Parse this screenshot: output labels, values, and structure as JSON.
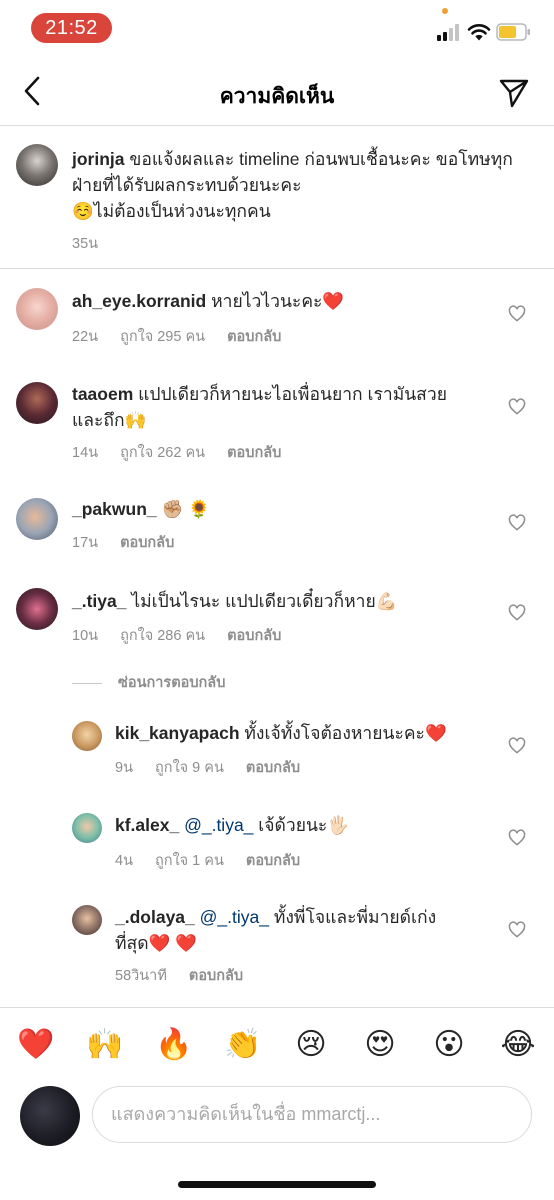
{
  "status_bar": {
    "time": "21:52"
  },
  "header": {
    "title": "ความคิดเห็น"
  },
  "caption": {
    "username": "jorinja",
    "text_line1": " ขอแจ้งผลและ timeline ก่อนพบเชื้อนะคะ ขอโทษทุก",
    "text_line2": "ฝ่ายที่ได้รับผลกระทบด้วยนะคะ",
    "text_line3": "☺️ไม่ต้องเป็นห่วงนะทุกคน",
    "time": "35น"
  },
  "comments": [
    {
      "username": "ah_eye.korranid",
      "text": " หายไวไวนะคะ❤️",
      "time": "22น",
      "likes": "ถูกใจ 295 คน",
      "reply": "ตอบกลับ"
    },
    {
      "username": "taaoem",
      "text": " แปปเดียวก็หายนะไอเพื่อนยาก เรามันสวย",
      "text2": "และถึก🙌",
      "time": "14น",
      "likes": "ถูกใจ 262 คน",
      "reply": "ตอบกลับ"
    },
    {
      "username": "_pakwun_",
      "text": " ✊🏼 🌻",
      "time": "17น",
      "reply": "ตอบกลับ"
    },
    {
      "username": "_.tiya_",
      "text": " ไม่เป็นไรนะ แปปเดียวเดี๋ยวก็หาย💪🏻",
      "time": "10น",
      "likes": "ถูกใจ 286 คน",
      "reply": "ตอบกลับ"
    }
  ],
  "hide_replies": "ซ่อนการตอบกลับ",
  "replies": [
    {
      "username": "kik_kanyapach",
      "text": " ทั้งเจ้ทั้งโจต้องหายนะคะ❤️",
      "time": "9น",
      "likes": "ถูกใจ 9 คน",
      "reply": "ตอบกลับ"
    },
    {
      "username": "kf.alex_",
      "mention": " @_.tiya_",
      "text": " เจ้ด้วยนะ🖐🏻",
      "time": "4น",
      "likes": "ถูกใจ 1 คน",
      "reply": "ตอบกลับ"
    },
    {
      "username": "_.dolaya_",
      "mention": " @_.tiya_",
      "text": "  ทั้งพี่โจและพี่มายด์เก่ง",
      "text2": "ที่สุด❤️ ❤️",
      "time": "58วินาที",
      "reply": "ตอบกลับ"
    }
  ],
  "emoji_bar": [
    "❤️",
    "🙌",
    "🔥",
    "👏",
    "😢",
    "😍",
    "😮",
    "😂"
  ],
  "comment_input": {
    "placeholder": "แสดงความคิดเห็นในชื่อ mmarctj..."
  }
}
